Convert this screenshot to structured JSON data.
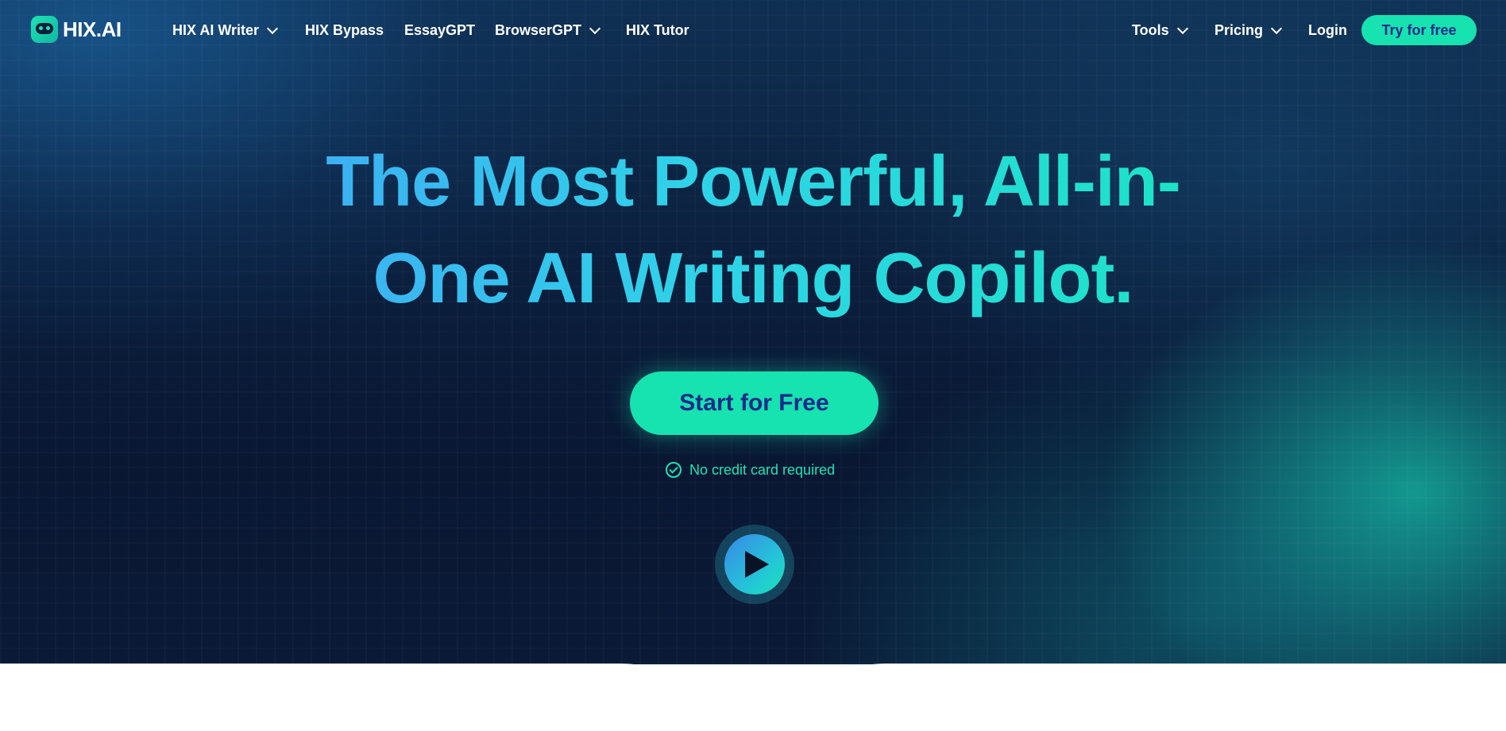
{
  "nav": {
    "logo_text": "HIX.AI",
    "items": [
      {
        "label": "HIX AI Writer",
        "has_dropdown": true
      },
      {
        "label": "HIX Bypass",
        "has_dropdown": false
      },
      {
        "label": "EssayGPT",
        "has_dropdown": false
      },
      {
        "label": "BrowserGPT",
        "has_dropdown": true
      },
      {
        "label": "HIX Tutor",
        "has_dropdown": false
      }
    ],
    "right_items": [
      {
        "label": "Tools",
        "has_dropdown": true
      },
      {
        "label": "Pricing",
        "has_dropdown": true
      },
      {
        "label": "Login",
        "has_dropdown": false
      }
    ],
    "cta_label": "Try for free"
  },
  "hero": {
    "headline_line1": "The Most Powerful, All-in-",
    "headline_line2": "One AI Writing Copilot.",
    "cta_label": "Start for Free",
    "note": "No credit card required"
  },
  "colors": {
    "accent": "#16e3b0",
    "button_text": "#1b2a8a",
    "hero_bg": "#0b1f3d"
  },
  "icons": [
    "logo-icon",
    "chevron-down-icon",
    "check-circle-icon",
    "play-icon"
  ]
}
